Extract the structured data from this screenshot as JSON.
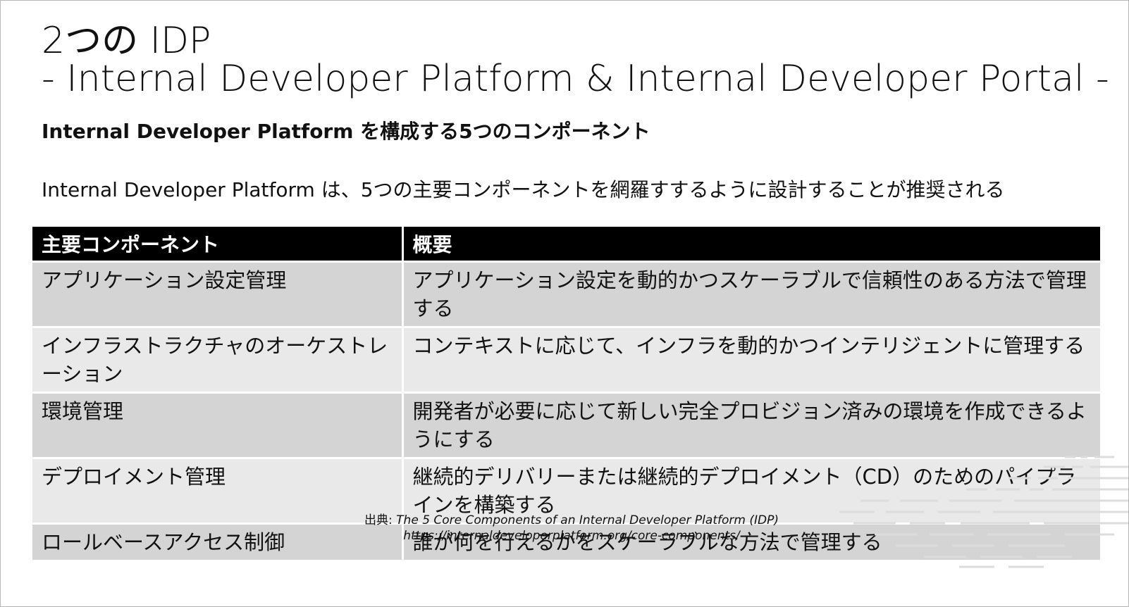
{
  "slide": {
    "title_line1": "2つの IDP",
    "title_line2": "- Internal Developer Platform & Internal Developer Portal -",
    "subtitle": "Internal Developer Platform を構成する5つのコンポーネント",
    "lead": "Internal Developer Platform は、5つの主要コンポーネントを網羅すするように設計することが推奨される"
  },
  "table": {
    "headers": [
      "主要コンポーネント",
      "概要"
    ],
    "rows": [
      {
        "component": "アプリケーション設定管理",
        "summary": "アプリケーション設定を動的かつスケーラブルで信頼性のある方法で管理する"
      },
      {
        "component": "インフラストラクチャのオーケストレーション",
        "summary": "コンテキストに応じて、インフラを動的かつインテリジェントに管理する"
      },
      {
        "component": "環境管理",
        "summary": "開発者が必要に応じて新しい完全プロビジョン済みの環境を作成できるようにする"
      },
      {
        "component": "デプロイメント管理",
        "summary": "継続的デリバリーまたは継続的デプロイメント（CD）のためのパイプラインを構築する"
      },
      {
        "component": "ロールベースアクセス制御",
        "summary": "誰が何を行えるかをスケーラブルな方法で管理する"
      }
    ]
  },
  "source": {
    "prefix": "出典: ",
    "title": "The 5 Core Components of an Internal Developer Platform (IDP)",
    "url": "https://internaldeveloperplatform.org/core-components/"
  }
}
